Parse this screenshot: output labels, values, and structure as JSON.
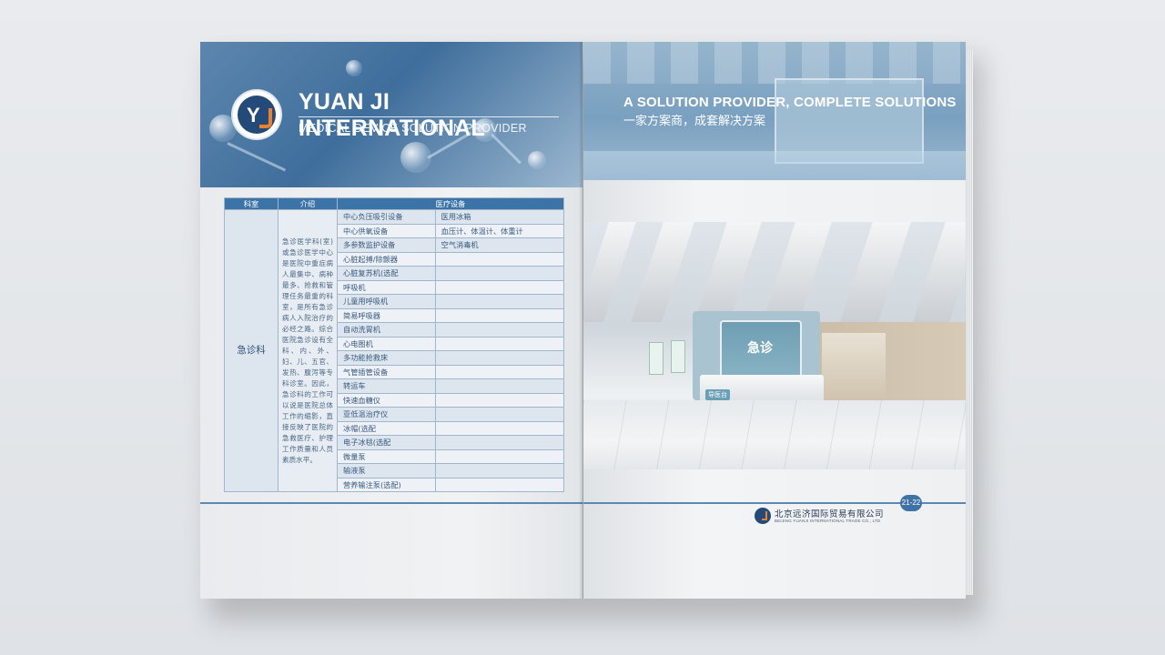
{
  "left_page": {
    "brand_title": "YUAN JI INTERNATIONAL",
    "brand_subtitle": "MEDICAL DEVICE SOLUTION PROVIDER",
    "logo_icon": "yuanji-logo-icon",
    "table": {
      "headers": [
        "科室",
        "介绍",
        "医疗设备"
      ],
      "department": "急诊科",
      "introduction": "急诊医学科(室)或急诊医学中心是医院中重症病人最集中、病种最多、抢救和管理任务最重的科室，是所有急诊病人入院治疗的必经之路。综合医院急诊设有全科、内、外、妇、儿、五官、发热、腹泻等专科诊室。因此，急诊科的工作可以说是医院总体工作的缩影，直接反映了医院的急救医疗、护理工作质量和人员素质水平。",
      "equipment_rows": [
        [
          "中心负压吸引设备",
          "医用冰箱"
        ],
        [
          "中心供氧设备",
          "血压计、体温计、体重计"
        ],
        [
          "多参数监护设备",
          "空气消毒机"
        ],
        [
          "心脏起搏/除颤器",
          ""
        ],
        [
          "心脏复苏机(选配",
          ""
        ],
        [
          "呼吸机",
          ""
        ],
        [
          "儿童用呼吸机",
          ""
        ],
        [
          "简易呼吸器",
          ""
        ],
        [
          "自动洗胃机",
          ""
        ],
        [
          "心电图机",
          ""
        ],
        [
          "多功能抢救床",
          ""
        ],
        [
          "气管插管设备",
          ""
        ],
        [
          "转运车",
          ""
        ],
        [
          "快速血糖仪",
          ""
        ],
        [
          "亚低温治疗仪",
          ""
        ],
        [
          "冰帽(选配",
          ""
        ],
        [
          "电子冰毯(选配",
          ""
        ],
        [
          "微量泵",
          ""
        ],
        [
          "输液泵",
          ""
        ],
        [
          "营养输注泵(选配)",
          ""
        ]
      ]
    }
  },
  "right_page": {
    "headline": "A SOLUTION PROVIDER, COMPLETE SOLUTIONS",
    "subheadline": "一家方案商，成套解决方案",
    "photo_sign": "急诊",
    "photo_desk_label": "导医台",
    "page_number": "21-22",
    "footer_company_cn": "北京远济国际贸易有限公司",
    "footer_company_en": "BEIJING YUANJI INTERNATIONAL TRADE CO., LTD"
  },
  "colors": {
    "brand_blue": "#3c74a8",
    "accent_orange": "#e9812f",
    "dark_navy": "#244a7a"
  }
}
